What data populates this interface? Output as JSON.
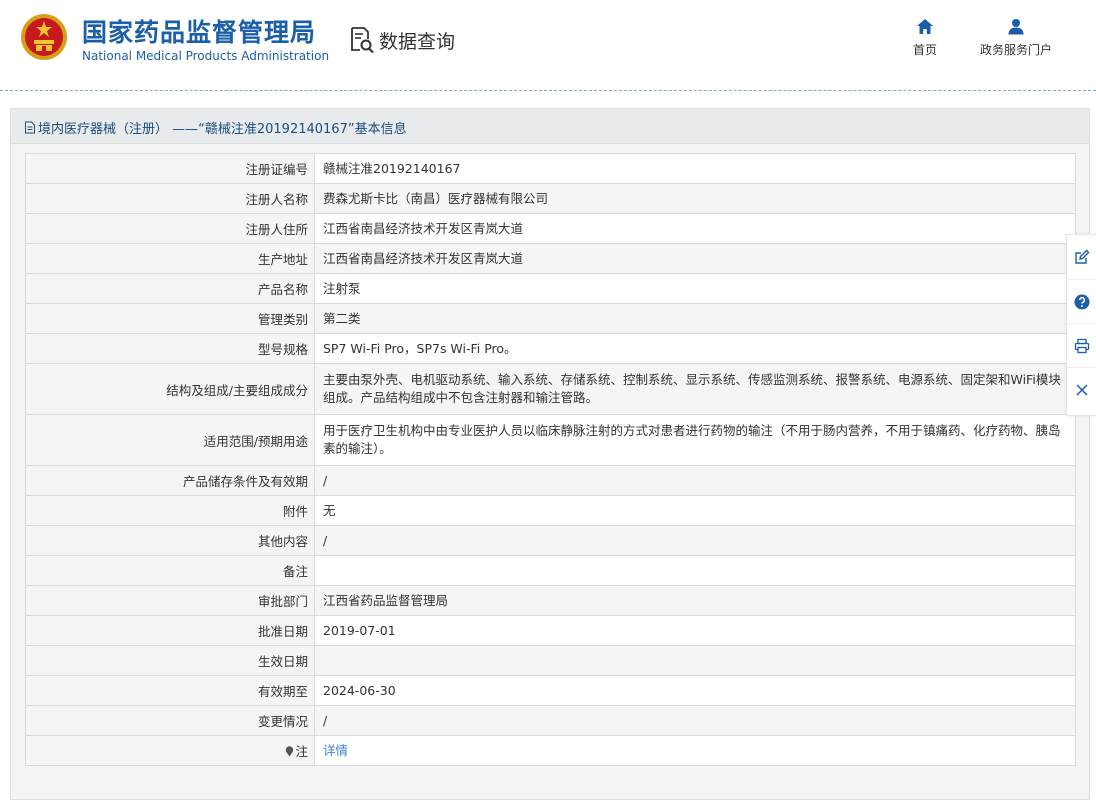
{
  "header": {
    "brand_cn": "国家药品监督管理局",
    "brand_en": "National Medical Products Administration",
    "section_title": "数据查询",
    "nav": {
      "home": "首页",
      "portal": "政务服务门户"
    }
  },
  "panel": {
    "title": "境内医疗器械（注册） ——“赣械注准20192140167”基本信息"
  },
  "rows": [
    {
      "label": "注册证编号",
      "value": "赣械注准20192140167"
    },
    {
      "label": "注册人名称",
      "value": "费森尤斯卡比（南昌）医疗器械有限公司"
    },
    {
      "label": "注册人住所",
      "value": "江西省南昌经济技术开发区青岚大道"
    },
    {
      "label": "生产地址",
      "value": "江西省南昌经济技术开发区青岚大道"
    },
    {
      "label": "产品名称",
      "value": "注射泵"
    },
    {
      "label": "管理类别",
      "value": "第二类"
    },
    {
      "label": "型号规格",
      "value": "SP7 Wi-Fi Pro，SP7s Wi-Fi Pro。"
    },
    {
      "label": "结构及组成/主要组成成分",
      "value": "主要由泵外壳、电机驱动系统、输入系统、存储系统、控制系统、显示系统、传感监测系统、报警系统、电源系统、固定架和WiFi模块组成。产品结构组成中不包含注射器和输注管路。"
    },
    {
      "label": "适用范围/预期用途",
      "value": "用于医疗卫生机构中由专业医护人员以临床静脉注射的方式对患者进行药物的输注（不用于肠内营养，不用于镇痛药、化疗药物、胰岛素的输注）。"
    },
    {
      "label": "产品储存条件及有效期",
      "value": "/"
    },
    {
      "label": "附件",
      "value": "无"
    },
    {
      "label": "其他内容",
      "value": "/"
    },
    {
      "label": "备注",
      "value": ""
    },
    {
      "label": "审批部门",
      "value": "江西省药品监督管理局"
    },
    {
      "label": "批准日期",
      "value": "2019-07-01"
    },
    {
      "label": "生效日期",
      "value": ""
    },
    {
      "label": "有效期至",
      "value": "2024-06-30"
    },
    {
      "label": "变更情况",
      "value": "/"
    },
    {
      "label": "注",
      "value": "详情"
    }
  ],
  "colors": {
    "brand": "#1a5fa8",
    "link": "#3b82d6",
    "nav_icon": "#1a5fa8"
  },
  "icons": {
    "home": "home-icon",
    "portal": "user-icon",
    "sidebar": [
      "edit-icon",
      "help-icon",
      "print-icon",
      "close-icon"
    ]
  }
}
